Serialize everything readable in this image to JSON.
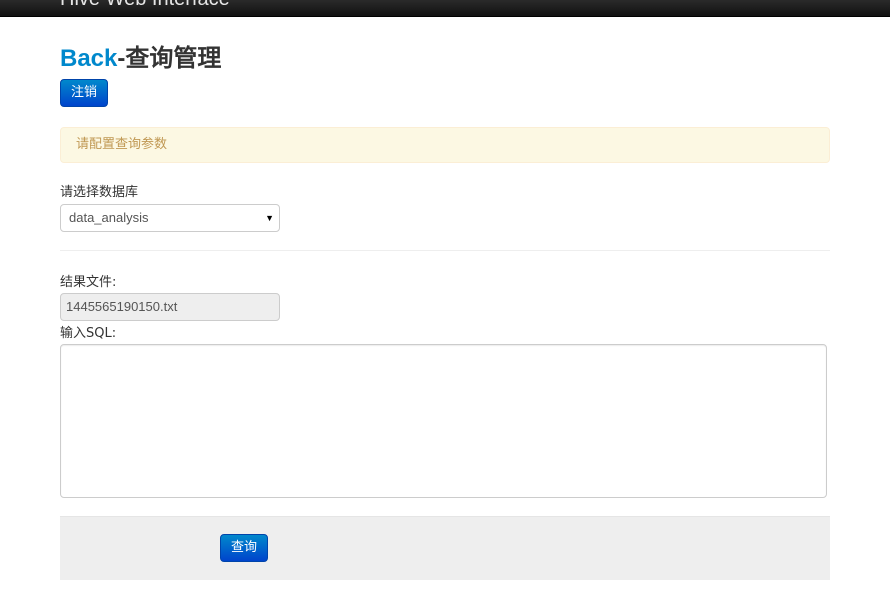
{
  "navbar": {
    "brand": "Hive Web Interface"
  },
  "header": {
    "back_label": "Back",
    "separator": "-",
    "title": "查询管理"
  },
  "buttons": {
    "logout_label": "注销",
    "query_label": "查询"
  },
  "alert": {
    "message": "请配置查询参数"
  },
  "form": {
    "database_label": "请选择数据库",
    "database_selected": "data_analysis",
    "result_file_label": "结果文件:",
    "result_file_value": "1445565190150.txt",
    "sql_label": "输入SQL:",
    "sql_value": ""
  },
  "icons": {
    "select_arrow": "chevron-down-icon"
  }
}
